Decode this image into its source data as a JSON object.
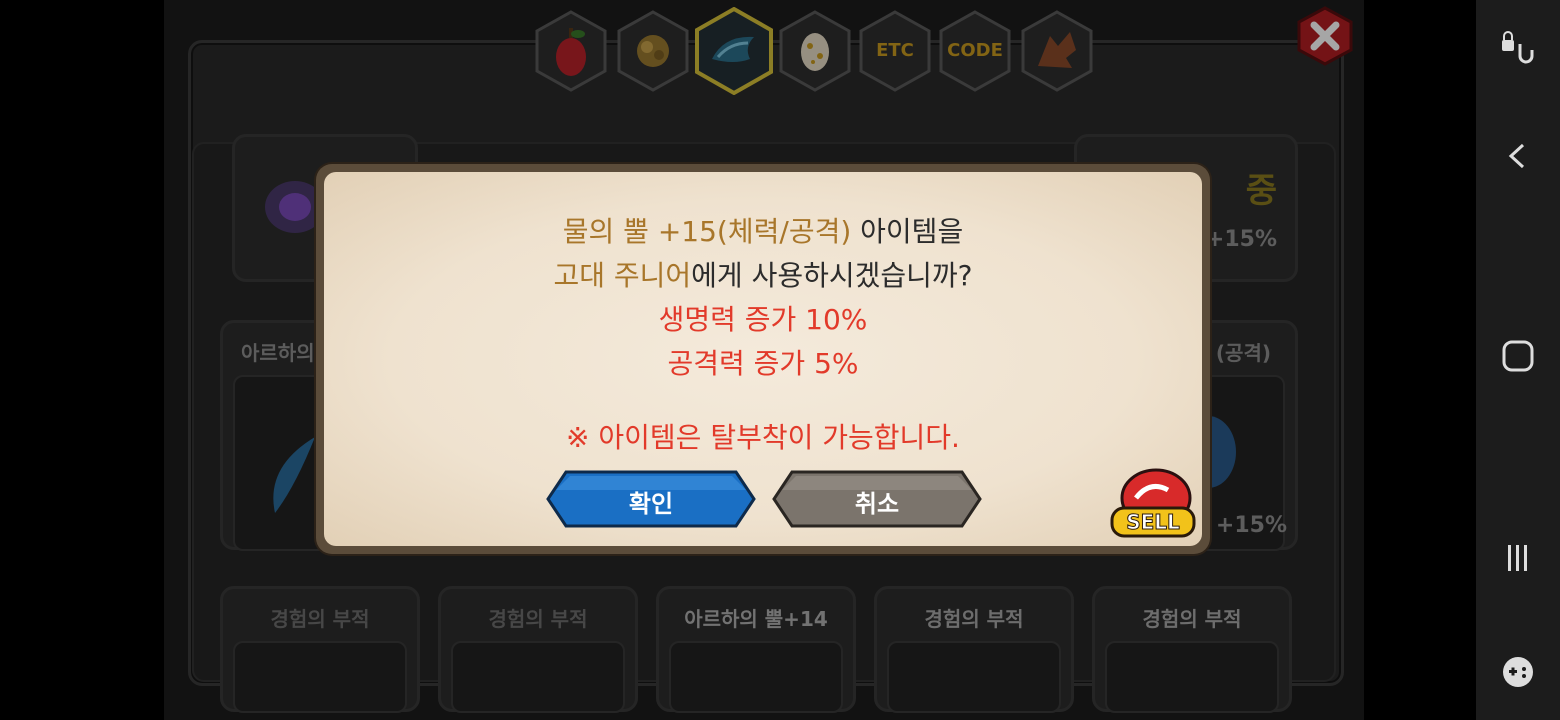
{
  "tabs": [
    {
      "name": "tab-fruit",
      "icon": "pear-icon",
      "label": ""
    },
    {
      "name": "tab-material",
      "icon": "ore-icon",
      "label": ""
    },
    {
      "name": "tab-dragon-horn",
      "icon": "horn-icon",
      "label": ""
    },
    {
      "name": "tab-egg",
      "icon": "egg-icon",
      "label": ""
    },
    {
      "name": "tab-etc",
      "icon": "",
      "label": "ETC"
    },
    {
      "name": "tab-code",
      "icon": "",
      "label": "CODE"
    },
    {
      "name": "tab-dragon",
      "icon": "dragon-icon",
      "label": ""
    }
  ],
  "background": {
    "cards_row2_left_title": "아르하의",
    "cards_row2_right_title": "(공격)",
    "right_top_text": "중",
    "pct_top": "+15%",
    "pct_mid": "+15%",
    "row3": [
      "경험의 부적",
      "경험의 부적",
      "아르하의 뿔+14",
      "경험의 부적",
      "경험의 부적"
    ]
  },
  "dialog": {
    "item_name": "물의 뿔 +15(체력/공격)",
    "line1_suffix": " 아이템을",
    "target_name": "고대 주니어",
    "line2_suffix": "에게 사용하시겠습니까?",
    "stat1": "생명력 증가 10%",
    "stat2": "공격력 증가 5%",
    "notice": "※ 아이템은 탈부착이 가능합니다.",
    "confirm_label": "확인",
    "cancel_label": "취소"
  },
  "sell_label": "SELL",
  "colors": {
    "gold_text": "#a8762a",
    "red_text": "#e23a2a",
    "confirm_button": "#1a6fc4",
    "cancel_button": "#7b746c"
  }
}
